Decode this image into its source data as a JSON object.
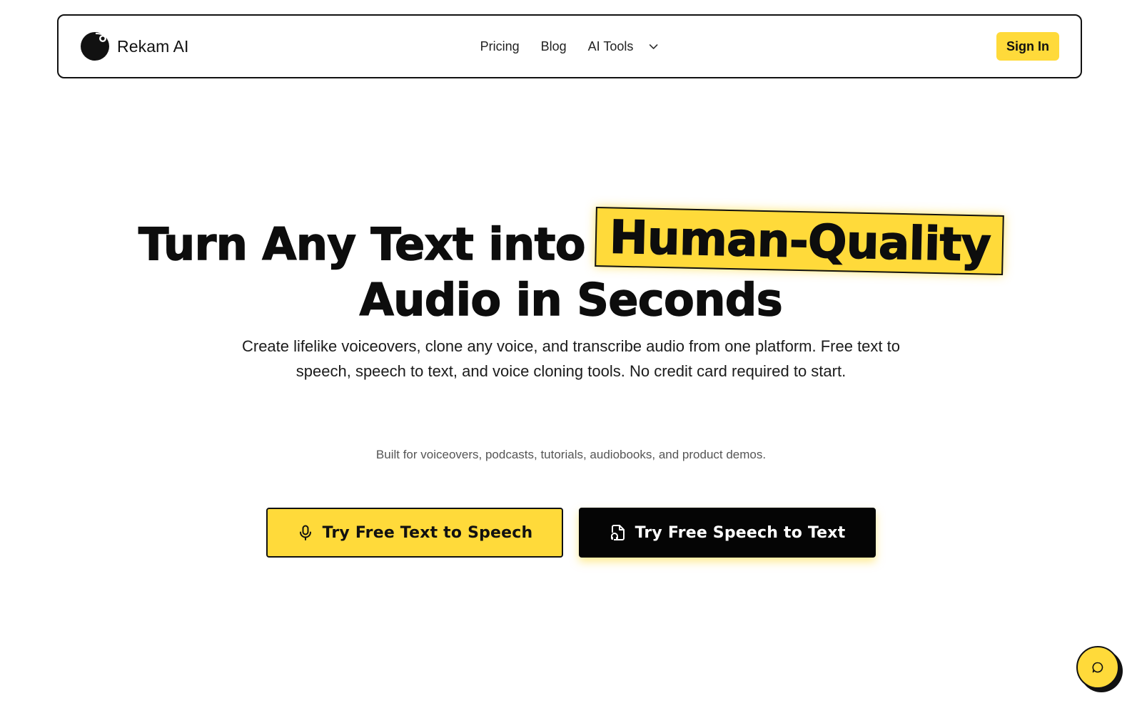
{
  "header": {
    "brand_name": "Rekam AI",
    "logo_icon": "logo-icon",
    "nav": [
      {
        "label": "Pricing"
      },
      {
        "label": "Blog"
      },
      {
        "label": "AI Tools",
        "icon": "chevron-down-icon"
      }
    ],
    "signin_label": "Sign In"
  },
  "hero": {
    "title_line1": "Turn Any Text into",
    "title_highlight": "Human-Quality",
    "title_line2": "Audio in Seconds",
    "subtitle": "Create lifelike voiceovers, clone any voice, and transcribe audio from one platform. Free text to speech, speech to text, and voice cloning tools. No credit card required to start.",
    "note": "Built for voiceovers, podcasts, tutorials, audiobooks, and product demos."
  },
  "cta": {
    "primary": {
      "label": "Try Free Text to Speech",
      "icon": "microphone-icon"
    },
    "secondary": {
      "label": "Try Free Speech to Text",
      "icon": "audio-file-icon"
    }
  },
  "chat": {
    "icon": "chat-bubble-icon"
  },
  "colors": {
    "accent": "#FFDA3A",
    "dark": "#050505",
    "text": "#111111",
    "muted": "#555555",
    "background": "#FFFFFF"
  }
}
